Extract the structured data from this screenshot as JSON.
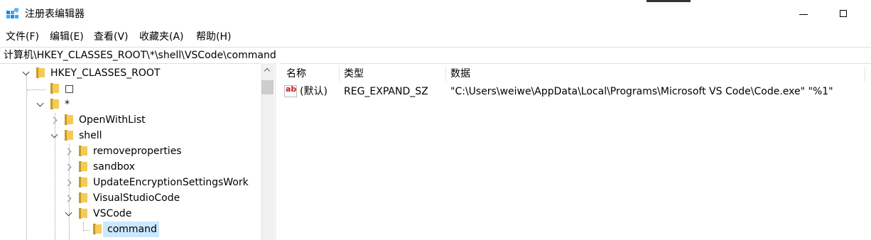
{
  "window": {
    "title": "注册表编辑器"
  },
  "menu": [
    {
      "label": "文件(F)"
    },
    {
      "label": "编辑(E)"
    },
    {
      "label": "查看(V)"
    },
    {
      "label": "收藏夹(A)"
    },
    {
      "label": "帮助(H)"
    }
  ],
  "address": {
    "path": "计算机\\HKEY_CLASSES_ROOT\\*\\shell\\VSCode\\command"
  },
  "tree": {
    "items": [
      {
        "label": "HKEY_CLASSES_ROOT",
        "state": "expanded"
      },
      {
        "label": "□",
        "state": "leaf"
      },
      {
        "label": "*",
        "state": "expanded"
      },
      {
        "label": "OpenWithList",
        "state": "collapsed"
      },
      {
        "label": "shell",
        "state": "expanded"
      },
      {
        "label": "removeproperties",
        "state": "collapsed"
      },
      {
        "label": "sandbox",
        "state": "collapsed"
      },
      {
        "label": "UpdateEncryptionSettingsWork",
        "state": "collapsed"
      },
      {
        "label": "VisualStudioCode",
        "state": "collapsed"
      },
      {
        "label": "VSCode",
        "state": "expanded"
      },
      {
        "label": "command",
        "state": "selected"
      }
    ]
  },
  "values": {
    "headers": {
      "name": "名称",
      "type": "类型",
      "data": "数据"
    },
    "rows": [
      {
        "icon": "string-value-icon",
        "name": "(默认)",
        "type": "REG_EXPAND_SZ",
        "data": "\"C:\\Users\\weiwe\\AppData\\Local\\Programs\\Microsoft VS Code\\Code.exe\" \"%1\""
      }
    ]
  },
  "colors": {
    "selection": "#cce8ff",
    "folder": "#f4cc55",
    "string_icon_text": "#c0201e"
  }
}
